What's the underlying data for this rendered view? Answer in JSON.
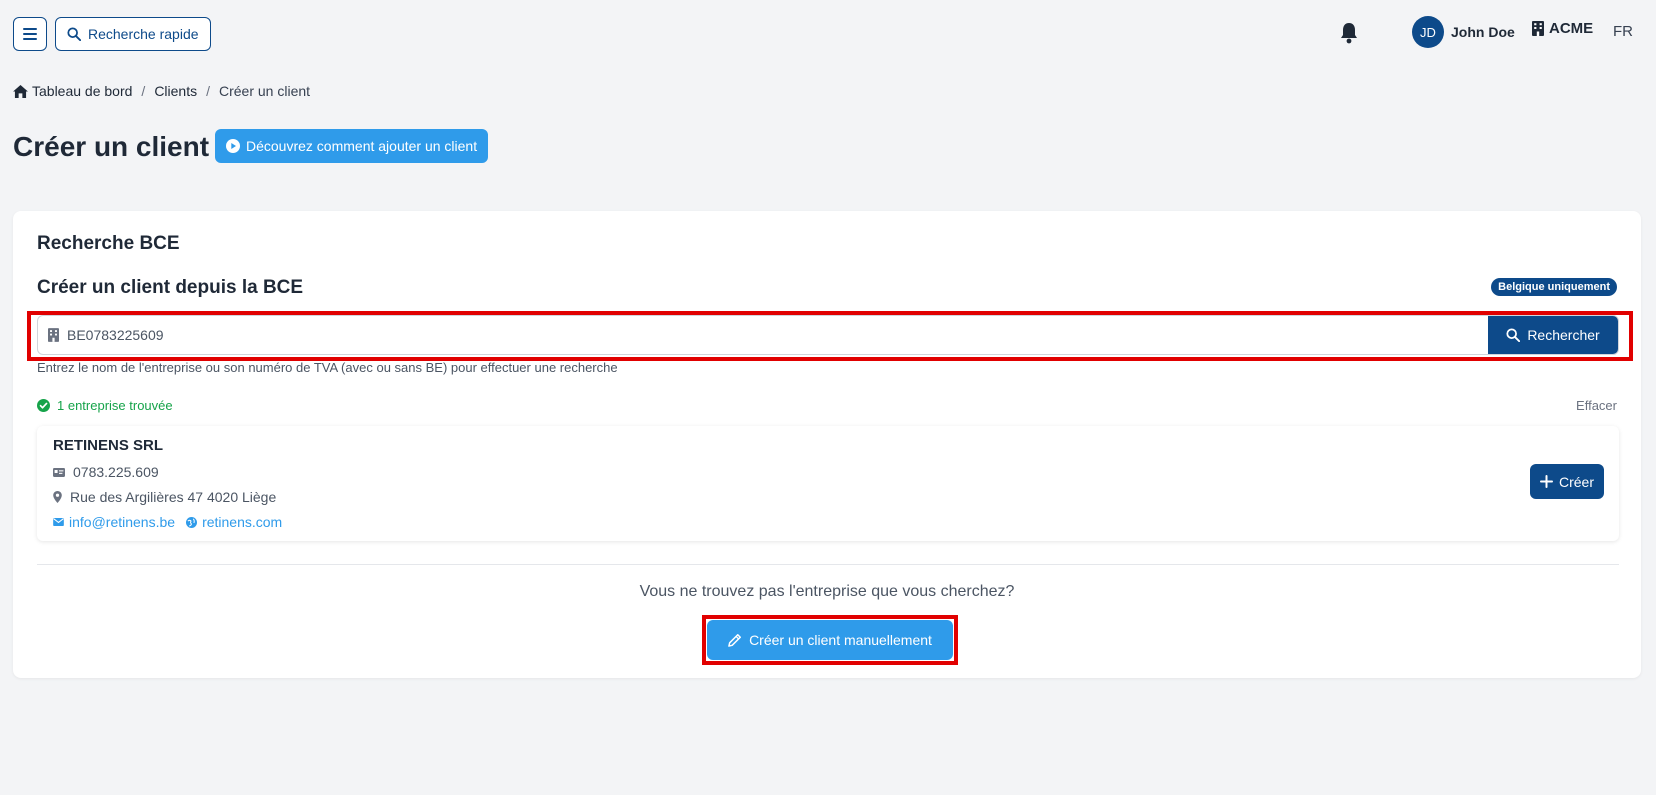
{
  "header": {
    "quick_search_label": "Recherche rapide",
    "user_initials": "JD",
    "user_name": "John Doe",
    "company_name": "ACME",
    "language": "FR"
  },
  "breadcrumb": {
    "items": [
      "Tableau de bord",
      "Clients",
      "Créer un client"
    ],
    "separator": "/"
  },
  "page": {
    "title": "Créer un client",
    "howto_button": "Découvrez comment ajouter un client"
  },
  "bce": {
    "section_title": "Recherche BCE",
    "subtitle": "Créer un client depuis la BCE",
    "badge": "Belgique uniquement",
    "search_value": "BE0783225609",
    "search_button": "Rechercher",
    "help_text": "Entrez le nom de l'entreprise ou son numéro de TVA (avec ou sans BE) pour effectuer une recherche",
    "results_count_text": "1 entreprise trouvée",
    "clear_label": "Effacer",
    "result": {
      "name": "RETINENS SRL",
      "vat": "0783.225.609",
      "address": "Rue des Argilières 47 4020 Liège",
      "email": "info@retinens.be",
      "website": "retinens.com",
      "create_button": "Créer"
    },
    "not_found_text": "Vous ne trouvez pas l'entreprise que vous cherchez?",
    "manual_button": "Créer un client manuellement"
  },
  "colors": {
    "primary": "#0d4a8a",
    "accent": "#2f9bea",
    "success": "#16a34a",
    "highlight": "#e10000"
  },
  "icons": [
    "menu-icon",
    "search-icon",
    "bell-icon",
    "building-icon",
    "home-icon",
    "play-circle-icon",
    "check-circle-icon",
    "id-card-icon",
    "map-pin-icon",
    "envelope-icon",
    "globe-icon",
    "plus-icon",
    "pencil-icon"
  ]
}
